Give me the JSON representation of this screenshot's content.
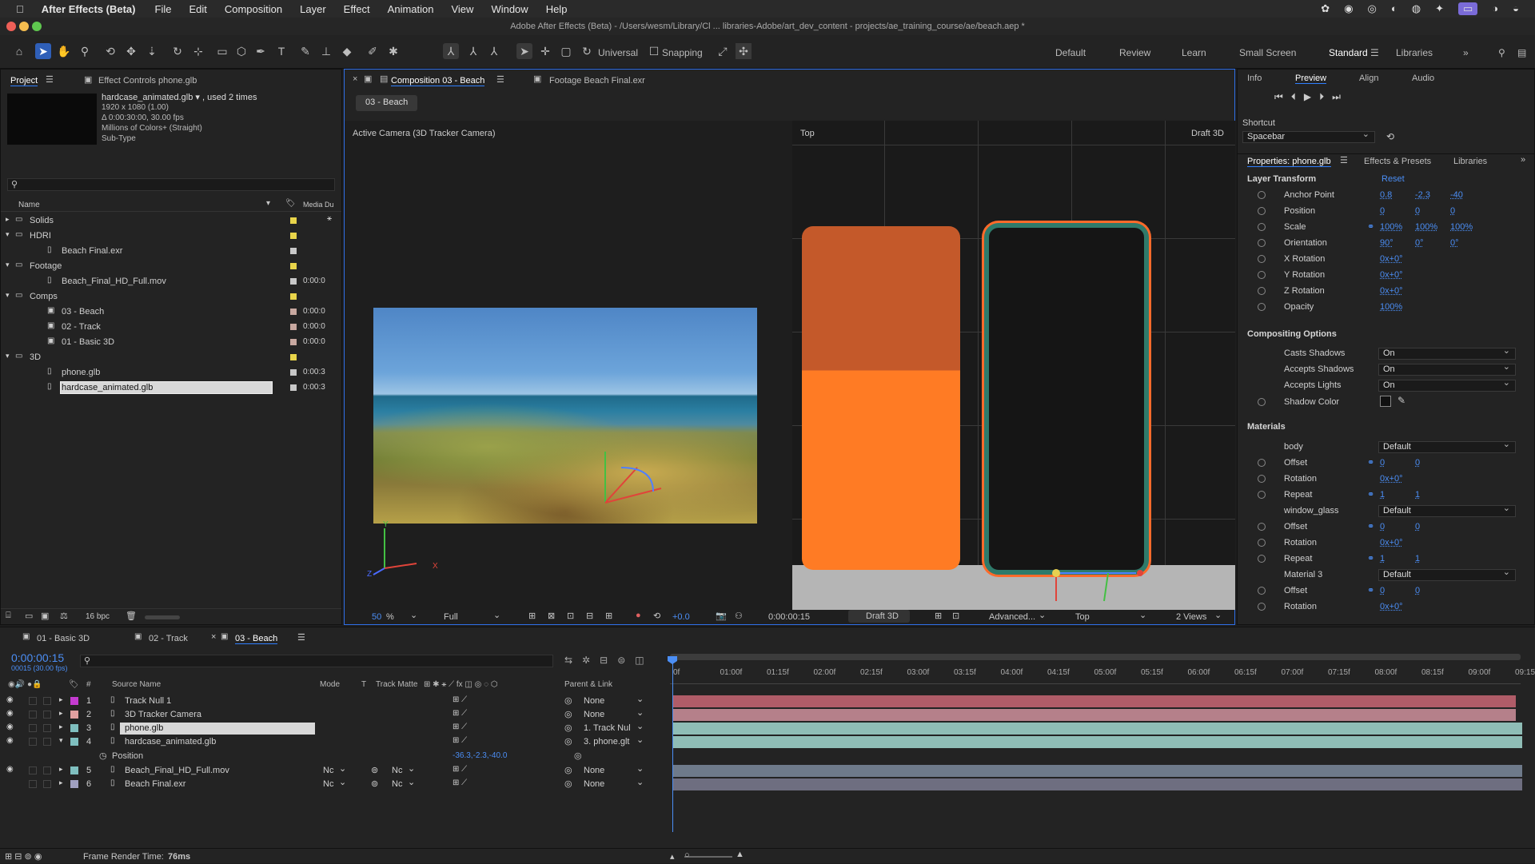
{
  "menubar": {
    "app": "After Effects (Beta)",
    "items": [
      "File",
      "Edit",
      "Composition",
      "Layer",
      "Effect",
      "Animation",
      "View",
      "Window",
      "Help"
    ]
  },
  "titlebar": {
    "title": "Adobe After Effects (Beta) - /Users/wesm/Library/Cl ... libraries-Adobe/art_dev_content - projects/ae_training_course/ae/beach.aep *"
  },
  "toolbar": {
    "universal": "Universal",
    "snapping": "Snapping",
    "workspaces": [
      "Default",
      "Review",
      "Learn",
      "Small Screen",
      "Standard",
      "Libraries"
    ]
  },
  "project": {
    "tab": "Project",
    "effect_tab": "Effect Controls phone.glb",
    "info_name": "hardcase_animated.glb ▾ , used 2 times",
    "info_dims": "1920 x 1080 (1.00)",
    "info_dur": "Δ 0:00:30:00, 30.00 fps",
    "info_colors": "Millions of Colors+ (Straight)",
    "info_sub": "Sub-Type",
    "search_placeholder": "",
    "col_name": "Name",
    "col_media": "Media Du",
    "items": [
      {
        "name": "Solids",
        "dur": ""
      },
      {
        "name": "HDRI",
        "dur": ""
      },
      {
        "name": "Beach Final.exr",
        "dur": ""
      },
      {
        "name": "Footage",
        "dur": ""
      },
      {
        "name": "Beach_Final_HD_Full.mov",
        "dur": "0:00:0"
      },
      {
        "name": "Comps",
        "dur": ""
      },
      {
        "name": "03 - Beach",
        "dur": "0:00:0"
      },
      {
        "name": "02 - Track",
        "dur": "0:00:0"
      },
      {
        "name": "01 - Basic 3D",
        "dur": "0:00:0"
      },
      {
        "name": "3D",
        "dur": ""
      },
      {
        "name": "phone.glb",
        "dur": "0:00:3"
      },
      {
        "name": "hardcase_animated.glb",
        "dur": "0:00:3"
      }
    ],
    "bpc": "16 bpc"
  },
  "comp": {
    "tab": "Composition 03 - Beach",
    "footage_tab": "Footage Beach Final.exr",
    "crumb": "03 - Beach",
    "left_label": "Active Camera (3D Tracker Camera)",
    "right_label": "Top",
    "draft": "Draft 3D",
    "axis_x": "X",
    "axis_y": "Y",
    "axis_z": "Z",
    "zoom": "50",
    "zoom_unit": "%",
    "res": "Full",
    "exposure": "+0.0",
    "timecode": "0:00:00:15",
    "draft_btn": "Draft 3D",
    "advanced": "Advanced...",
    "view": "Top",
    "views": "2 Views"
  },
  "right": {
    "tabs": [
      "Info",
      "Preview",
      "Align",
      "Audio"
    ],
    "shortcut_label": "Shortcut",
    "shortcut": "Spacebar",
    "props_tab": "Properties: phone.glb",
    "effects_tab": "Effects & Presets",
    "libraries_tab": "Libraries",
    "layer_transform": "Layer Transform",
    "reset": "Reset",
    "transform": [
      {
        "label": "Anchor Point",
        "v": [
          "0.8",
          "-2.3",
          "-40"
        ]
      },
      {
        "label": "Position",
        "v": [
          "0",
          "0",
          "0"
        ]
      },
      {
        "label": "Scale",
        "v": [
          "100%",
          "100%",
          "100%"
        ]
      },
      {
        "label": "Orientation",
        "v": [
          "90°",
          "0°",
          "0°"
        ]
      },
      {
        "label": "X Rotation",
        "v": [
          "0x+0°"
        ]
      },
      {
        "label": "Y Rotation",
        "v": [
          "0x+0°"
        ]
      },
      {
        "label": "Z Rotation",
        "v": [
          "0x+0°"
        ]
      },
      {
        "label": "Opacity",
        "v": [
          "100%"
        ]
      }
    ],
    "compositing": "Compositing Options",
    "comp_opts": [
      {
        "label": "Casts Shadows",
        "v": "On"
      },
      {
        "label": "Accepts Shadows",
        "v": "On"
      },
      {
        "label": "Accepts Lights",
        "v": "On"
      }
    ],
    "shadow_color": "Shadow Color",
    "materials": "Materials",
    "mat": [
      {
        "label": "body",
        "v": "Default",
        "type": "sel"
      },
      {
        "label": "Offset",
        "v": [
          "0",
          "0"
        ]
      },
      {
        "label": "Rotation",
        "v": [
          "0x+0°"
        ]
      },
      {
        "label": "Repeat",
        "v": [
          "1",
          "1"
        ]
      },
      {
        "label": "window_glass",
        "v": "Default",
        "type": "sel"
      },
      {
        "label": "Offset",
        "v": [
          "0",
          "0"
        ]
      },
      {
        "label": "Rotation",
        "v": [
          "0x+0°"
        ]
      },
      {
        "label": "Repeat",
        "v": [
          "1",
          "1"
        ]
      },
      {
        "label": "Material 3",
        "v": "Default",
        "type": "sel"
      },
      {
        "label": "Offset",
        "v": [
          "0",
          "0"
        ]
      },
      {
        "label": "Rotation",
        "v": [
          "0x+0°"
        ]
      }
    ]
  },
  "timeline": {
    "tabs": [
      "01 - Basic 3D",
      "02 - Track",
      "03 - Beach"
    ],
    "timecode": "0:00:00:15",
    "frames": "00015 (30.00 fps)",
    "cols": {
      "src": "Source Name",
      "mode": "Mode",
      "t": "T",
      "matte": "Track Matte",
      "parent": "Parent & Link"
    },
    "layers": [
      {
        "num": "1",
        "name": "Track Null 1",
        "parent": "None",
        "color": "#c43bd0",
        "bar": "#b05c68"
      },
      {
        "num": "2",
        "name": "3D Tracker Camera",
        "parent": "None",
        "color": "#e0a0a0",
        "bar": "#b5808a"
      },
      {
        "num": "3",
        "name": "phone.glb",
        "parent": "1. Track Nul",
        "color": "#7fbfbf",
        "bar": "#8fbdb6"
      },
      {
        "num": "4",
        "name": "hardcase_animated.glb",
        "parent": "3. phone.glt",
        "color": "#7fbfbf",
        "bar": "#8fbdb6"
      },
      {
        "num": "5",
        "name": "Beach_Final_HD_Full.mov",
        "parent": "None",
        "color": "#7fbfbf",
        "bar": "#6e7a8a",
        "mode": "Nc",
        "matte": "Nc"
      },
      {
        "num": "6",
        "name": "Beach Final.exr",
        "parent": "None",
        "color": "#a0a0c0",
        "bar": "#6e6e80",
        "mode": "Nc",
        "matte": "Nc"
      }
    ],
    "position_label": "Position",
    "position_val": "-36.3,-2.3,-40.0",
    "ticks": [
      "0f",
      "01:00f",
      "01:15f",
      "02:00f",
      "02:15f",
      "03:00f",
      "03:15f",
      "04:00f",
      "04:15f",
      "05:00f",
      "05:15f",
      "06:00f",
      "06:15f",
      "07:00f",
      "07:15f",
      "08:00f",
      "08:15f",
      "09:00f",
      "09:15"
    ],
    "render_label": "Frame Render Time:",
    "render_val": "76ms"
  }
}
